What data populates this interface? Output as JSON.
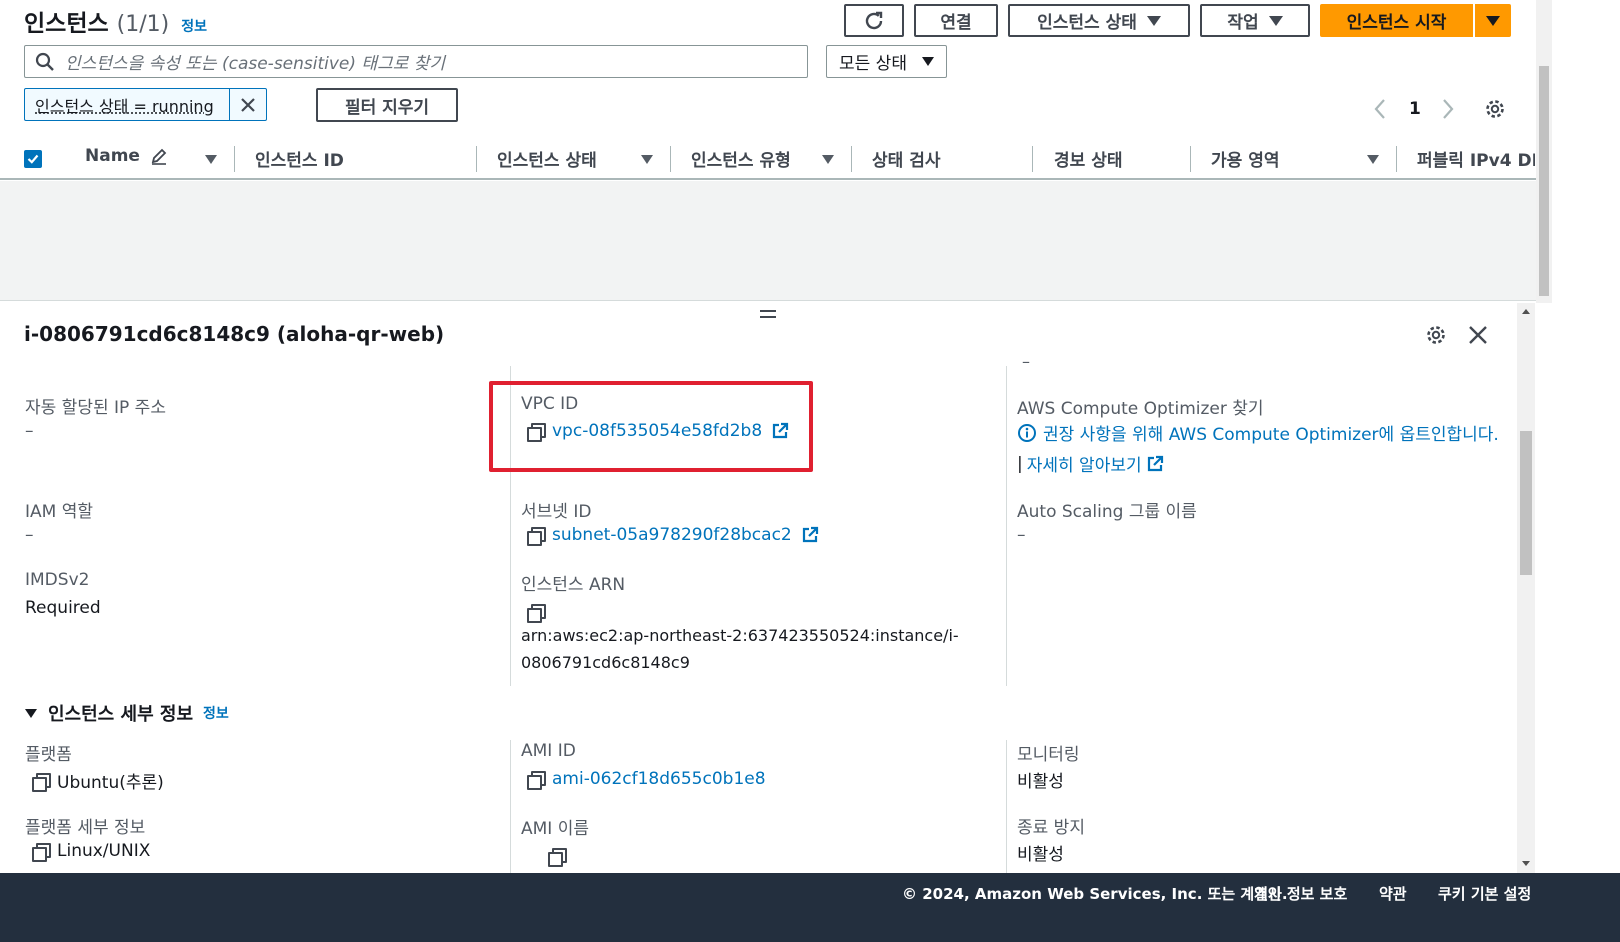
{
  "header": {
    "title": "인스턴스",
    "count": "(1/1)",
    "info": "정보"
  },
  "toolbar": {
    "refresh_icon": "refresh-icon",
    "connect": "연결",
    "instance_state": "인스턴스 상태",
    "actions": "작업",
    "launch": "인스턴스 시작"
  },
  "search": {
    "placeholder": "인스턴스을 속성 또는 (case-sensitive) 태그로 찾기",
    "state_filter": "모든 상태"
  },
  "filter": {
    "token": "인스턴스 상태 = running",
    "clear": "필터 지우기"
  },
  "pagination": {
    "page": "1"
  },
  "table": {
    "columns": [
      "Name",
      "인스턴스 ID",
      "인스턴스 상태",
      "인스턴스 유형",
      "상태 검사",
      "경보 상태",
      "가용 영역",
      "퍼블릭 IPv4 DN"
    ]
  },
  "detail": {
    "title": "i-0806791cd6c8148c9 (aloha-qr-web)",
    "col1": {
      "auto_ip_label": "자동 할당된 IP 주소",
      "auto_ip_value": "–",
      "iam_label": "IAM 역할",
      "iam_value": "–",
      "imds_label": "IMDSv2",
      "imds_value": "Required"
    },
    "col2": {
      "vpc_label": "VPC ID",
      "vpc_value": "vpc-08f535054e58fd2b8",
      "subnet_label": "서브넷 ID",
      "subnet_value": "subnet-05a978290f28bcac2",
      "arn_label": "인스턴스 ARN",
      "arn_value_1": "arn:aws:ec2:ap-northeast-2:637423550524:instance/i-",
      "arn_value_2": "0806791cd6c8148c9"
    },
    "col3": {
      "top_dash": "–",
      "optimizer_label": "AWS Compute Optimizer 찾기",
      "optimizer_text": "권장 사항을 위해 AWS Compute Optimizer에 옵트인합니다.",
      "learn_more": "자세히 알아보기",
      "asg_label": "Auto Scaling 그룹 이름",
      "asg_value": "–"
    },
    "details_section": {
      "title": "인스턴스 세부 정보",
      "info": "정보",
      "platform_label": "플랫폼",
      "platform_value": "Ubuntu(추론)",
      "platform_detail_label": "플랫폼 세부 정보",
      "platform_detail_value": "Linux/UNIX",
      "ami_id_label": "AMI ID",
      "ami_id_value": "ami-062cf18d655c0b1e8",
      "ami_name_label": "AMI 이름",
      "monitoring_label": "모니터링",
      "monitoring_value": "비활성",
      "termination_label": "종료 방지",
      "termination_value": "비활성"
    }
  },
  "footer": {
    "copyright": "© 2024, Amazon Web Services, Inc. 또는 계열사.",
    "privacy": "개인 정보 보호",
    "terms": "약관",
    "cookies": "쿠키 기본 설정"
  },
  "colors": {
    "accent_orange": "#ff9900",
    "link_blue": "#0073bb",
    "highlight_red": "#e02030",
    "footer_bg": "#232f3e"
  }
}
